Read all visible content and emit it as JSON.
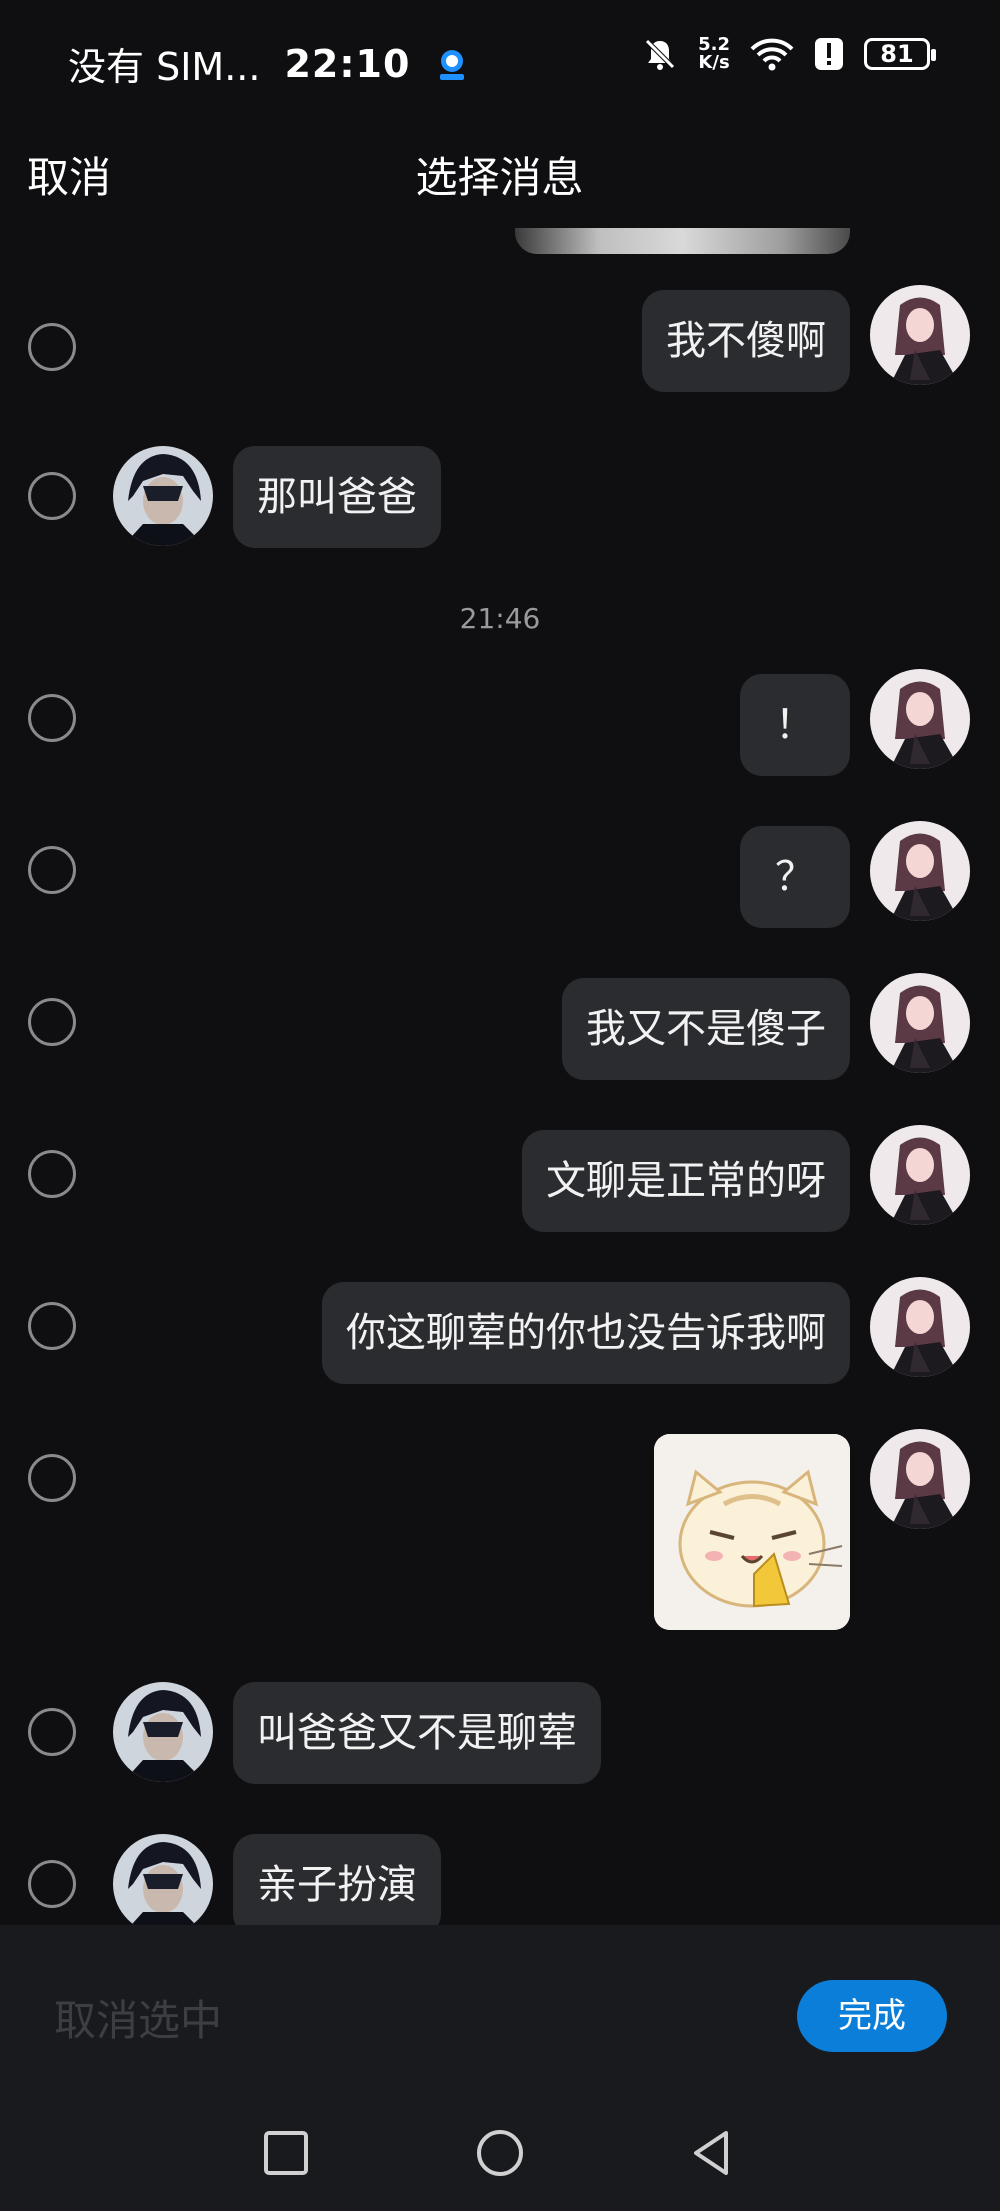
{
  "status_bar": {
    "carrier": "没有 SIM...",
    "time": "22:10",
    "speed_value": "5.2",
    "speed_unit": "K/s",
    "battery": "81"
  },
  "header": {
    "cancel_label": "取消",
    "title": "选择消息"
  },
  "messages": [
    {
      "sender": "self",
      "type": "text",
      "text": "我不傻啊"
    },
    {
      "sender": "other",
      "type": "text",
      "text": "那叫爸爸"
    },
    {
      "type": "timestamp",
      "text": "21:46"
    },
    {
      "sender": "self",
      "type": "text",
      "text": "！"
    },
    {
      "sender": "self",
      "type": "text",
      "text": "？"
    },
    {
      "sender": "self",
      "type": "text",
      "text": "我又不是傻子"
    },
    {
      "sender": "self",
      "type": "text",
      "text": "文聊是正常的呀"
    },
    {
      "sender": "self",
      "type": "text",
      "text": "你这聊荤的你也没告诉我啊"
    },
    {
      "sender": "self",
      "type": "sticker",
      "sticker": "cat-sticker"
    },
    {
      "sender": "other",
      "type": "text",
      "text": "叫爸爸又不是聊荤"
    },
    {
      "sender": "other",
      "type": "text",
      "text": "亲子扮演"
    }
  ],
  "action_bar": {
    "deselect_label": "取消选中",
    "done_label": "完成"
  },
  "colors": {
    "background": "#0f0f12",
    "bubble": "#2b2c30",
    "accent": "#0a7ed8",
    "action_bar": "#191a1e"
  }
}
